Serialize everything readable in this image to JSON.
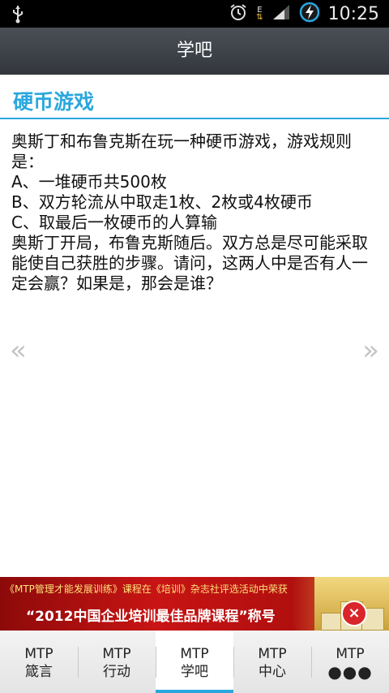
{
  "status_bar": {
    "time": "10:25",
    "network_label": "E",
    "icons": [
      "usb-icon",
      "alarm-icon",
      "data-arrows-icon",
      "signal-icon",
      "battery-charging-icon"
    ]
  },
  "header": {
    "title": "学吧"
  },
  "section": {
    "title": "硬币游戏"
  },
  "puzzle": {
    "lines": [
      "奥斯丁和布鲁克斯在玩一种硬币游戏，游戏规则是：",
      "A、一堆硬币共500枚",
      "B、双方轮流从中取走1枚、2枚或4枚硬币",
      "C、取最后一枚硬币的人算输",
      "奥斯丁开局，布鲁克斯随后。双方总是尽可能采取能使自己获胜的步骤。请问，这两人中是否有人一定会赢？如果是，那会是谁？"
    ]
  },
  "pager": {
    "prev": "«",
    "next": "»"
  },
  "ad": {
    "line1": "《MTP管理才能发展训练》课程在《培训》杂志社评选活动中荣获",
    "line2": "“2012中国企业培训最佳品牌课程”称号",
    "close": "×"
  },
  "bottom_nav": {
    "tabs": [
      {
        "line1": "MTP",
        "line2": "箴言",
        "active": false
      },
      {
        "line1": "MTP",
        "line2": "行动",
        "active": false
      },
      {
        "line1": "MTP",
        "line2": "学吧",
        "active": true
      },
      {
        "line1": "MTP",
        "line2": "中心",
        "active": false
      },
      {
        "line1": "MTP",
        "line2": "●●●",
        "active": false
      }
    ]
  },
  "colors": {
    "accent": "#2aa7de",
    "titlebar": "#3c4046",
    "ad_red": "#c81414"
  }
}
